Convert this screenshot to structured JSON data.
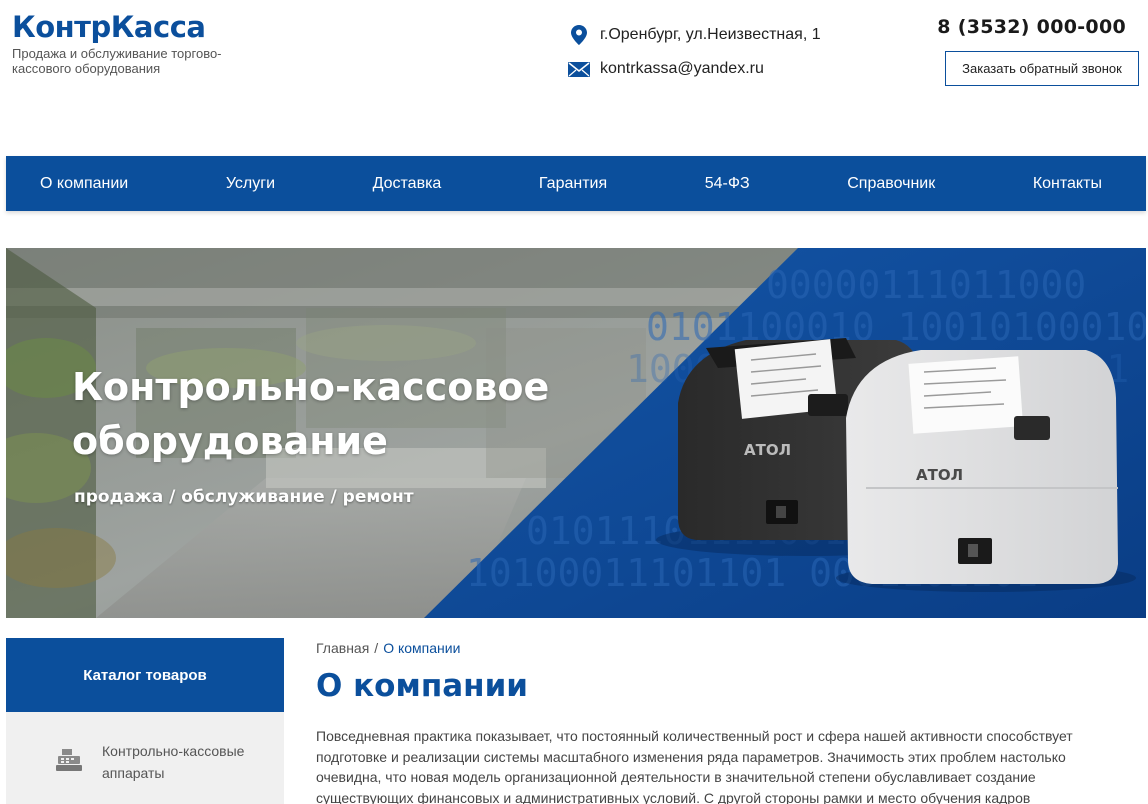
{
  "header": {
    "logo": "КонтрКасса",
    "tagline": "Продажа и обслуживание торгово-кассового оборудования",
    "address": "г.Оренбург, ул.Неизвестная, 1",
    "email": "kontrkassa@yandex.ru",
    "phone": "8 (3532) 000-000",
    "callback_label": "Заказать обратный звонок"
  },
  "nav": {
    "items": [
      "О компании",
      "Услуги",
      "Доставка",
      "Гарантия",
      "54-ФЗ",
      "Справочник",
      "Контакты"
    ]
  },
  "hero": {
    "title": "Контрольно-кассовое оборудование",
    "subtitle": "продажа / обслуживание / ремонт",
    "binary_text": "00000111011000 10010100010 10110 1111001111 1111 0001101101",
    "printer_brand": "АТОЛ"
  },
  "sidebar": {
    "catalog_title": "Каталог товаров",
    "items": [
      {
        "label": "Контрольно-кассовые аппараты",
        "icon": "cash-register-icon"
      }
    ]
  },
  "breadcrumb": {
    "home": "Главная",
    "separator": "/",
    "current": "О компании"
  },
  "content": {
    "title": "О компании",
    "paragraph": "Повседневная практика показывает, что постоянный количественный рост и сфера нашей активности способствует подготовке и реализации системы масштабного изменения ряда параметров. Значимость этих проблем настолько очевидна, что новая модель организационной деятельности в значительной степени обуславливает создание существующих финансовых и административных условий. С другой стороны рамки и место обучения кадров"
  },
  "colors": {
    "brand_blue": "#0b4f9c",
    "text": "#444444",
    "sidebar_bg": "#f0f0f0"
  }
}
